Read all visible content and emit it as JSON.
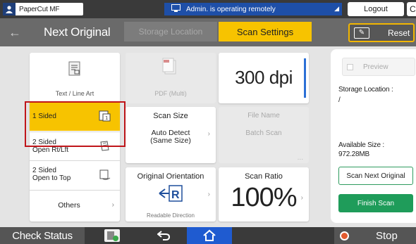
{
  "statusbar": {
    "user_name": "PaperCut MF",
    "remote_text": "Admin. is operating remotely",
    "logout_label": "Logout",
    "extra_label": "C"
  },
  "header": {
    "title": "Next Original",
    "tab_storage": "Storage Location",
    "tab_scan": "Scan Settings",
    "reset_label": "Reset"
  },
  "settings": {
    "type_label": "Text / Line Art",
    "file_type_label": "PDF (Multi)",
    "resolution": "300 dpi",
    "sides": [
      {
        "label": "1 Sided",
        "selected": true
      },
      {
        "label": "2 Sided\nOpen Rt/Lft",
        "selected": false
      },
      {
        "label": "2 Sided\nOpen to Top",
        "selected": false
      }
    ],
    "others_label": "Others",
    "scan_size_title": "Scan Size",
    "scan_size_value": "Auto Detect\n(Same Size)",
    "file_name_title": "File Name",
    "file_name_value": "Batch Scan",
    "file_name_more": "...",
    "orientation_title": "Original Orientation",
    "orientation_value": "Readable Direction",
    "ratio_title": "Scan Ratio",
    "ratio_value": "100%"
  },
  "panel": {
    "preview_label": "Preview",
    "storage_label": "Storage Location :",
    "storage_value": "/",
    "available_label": "Available Size :",
    "available_value": "972.28MB",
    "scan_next_label": "Scan Next Original",
    "finish_label": "Finish Scan"
  },
  "bottombar": {
    "check_status_label": "Check Status",
    "stop_label": "Stop"
  },
  "colors": {
    "accent_yellow": "#f7c300",
    "selection_red": "#c0151a",
    "finish_green": "#1f9c5a",
    "home_blue": "#1f5bd0"
  }
}
